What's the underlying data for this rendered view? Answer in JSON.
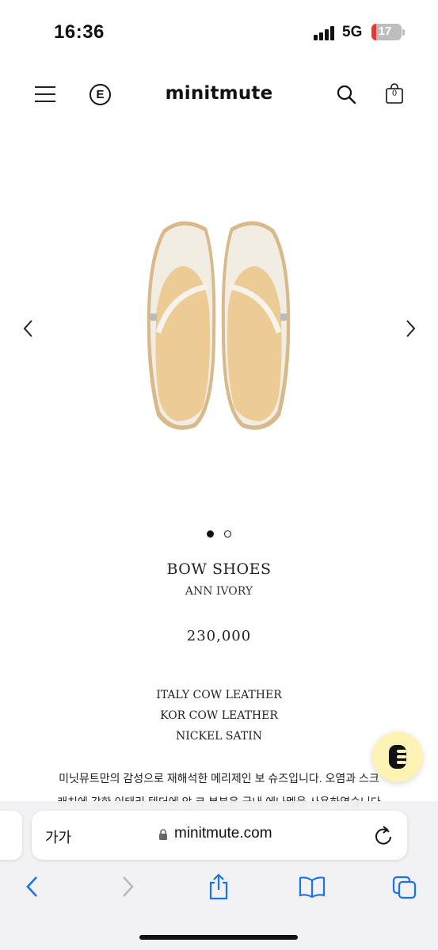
{
  "status_bar": {
    "time": "16:36",
    "network": "5G",
    "battery_level": "17",
    "battery_fraction": 0.17,
    "icons": [
      "signal-icon",
      "battery-icon"
    ]
  },
  "header": {
    "brand": "minitmute",
    "icons": [
      "menu-icon",
      "e-logo-icon",
      "search-icon",
      "cart-icon"
    ],
    "e_logo": "E",
    "cart_count": "0"
  },
  "gallery": {
    "icons": [
      "chevron-left-icon",
      "chevron-right-icon"
    ],
    "current_slide": 1,
    "total_slides": 2
  },
  "product": {
    "name": "BOW SHOES",
    "variant": "ANN IVORY",
    "price": "230,000",
    "materials": [
      "ITALY COW LEATHER",
      "KOR COW LEATHER",
      "NICKEL SATIN"
    ],
    "description_lines": [
      "미닛뮤트만의 감성으로 재해석한 메리제인 보 슈즈입니다. 오염과 스크",
      "래치에 강한 이태리 텐더에 앞 코 부분은 국내 에나멜을 사용하였습니다"
    ]
  },
  "chat": {
    "icon": "chat-e-icon",
    "color": "#fdf3b4"
  },
  "browser": {
    "text_size_label": "가가",
    "url": "minitmute.com",
    "icons": [
      "lock-icon",
      "reload-icon",
      "back-icon",
      "forward-icon",
      "share-icon",
      "bookmarks-icon",
      "tabs-icon"
    ],
    "accent_color": "#1a73e8"
  }
}
